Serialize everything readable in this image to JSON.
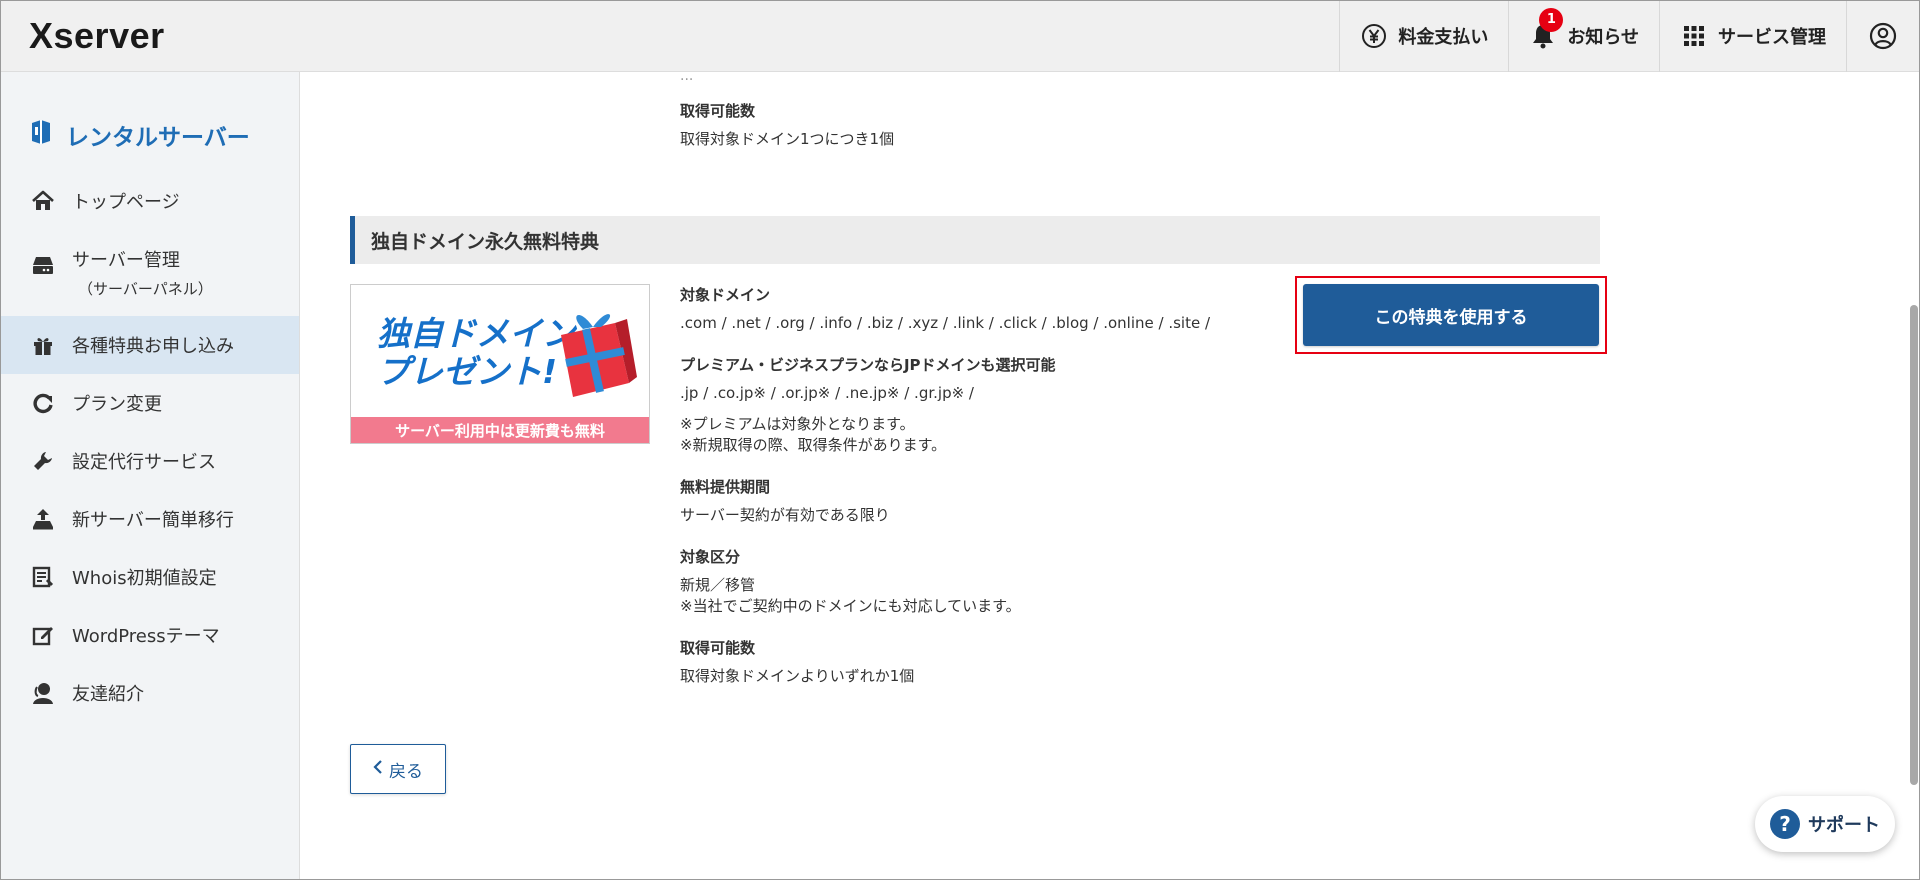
{
  "header": {
    "logo": "Xserver",
    "nav": {
      "payment": "料金支払い",
      "notifications": "お知らせ",
      "notification_count": "1",
      "service_management": "サービス管理"
    }
  },
  "sidebar": {
    "title": "レンタルサーバー",
    "items": [
      {
        "label": "トップページ",
        "icon": "home-icon"
      },
      {
        "label": "サーバー管理",
        "sub": "（サーバーパネル）",
        "icon": "server-icon"
      },
      {
        "label": "各種特典お申し込み",
        "icon": "gift-icon",
        "active": true
      },
      {
        "label": "プラン変更",
        "icon": "refresh-icon"
      },
      {
        "label": "設定代行サービス",
        "icon": "wrench-icon"
      },
      {
        "label": "新サーバー簡単移行",
        "icon": "upload-server-icon"
      },
      {
        "label": "Whois初期値設定",
        "icon": "document-icon"
      },
      {
        "label": "WordPressテーマ",
        "icon": "edit-icon"
      },
      {
        "label": "友達紹介",
        "icon": "user-icon"
      }
    ]
  },
  "main": {
    "cropped_text": "...",
    "top_block": {
      "label": "取得可能数",
      "value": "取得対象ドメイン1つにつき1個"
    },
    "section_title": "独自ドメイン永久無料特典",
    "promo": {
      "line1": "独自ドメイン",
      "line2": "プレゼント!",
      "band": "サーバー利用中は更新費も無料"
    },
    "details": {
      "target_domain_label": "対象ドメイン",
      "target_domain_value": ".com / .net / .org / .info / .biz / .xyz / .link / .click / .blog / .online / .site /",
      "premium_label": "プレミアム・ビジネスプランならJPドメインも選択可能",
      "premium_value": ".jp / .co.jp※ / .or.jp※ / .ne.jp※ / .gr.jp※ /",
      "premium_note1": "※プレミアムは対象外となります。",
      "premium_note2": "※新規取得の際、取得条件があります。",
      "period_label": "無料提供期間",
      "period_value": "サーバー契約が有効である限り",
      "category_label": "対象区分",
      "category_value": "新規／移管",
      "category_note": "※当社でご契約中のドメインにも対応しています。",
      "count_label": "取得可能数",
      "count_value": "取得対象ドメインよりいずれか1個"
    },
    "use_button": "この特典を使用する",
    "back_button": "戻る"
  },
  "support": {
    "label": "サポート"
  },
  "colors": {
    "brand_blue": "#1f5c99",
    "sidebar_active": "#d9e6f2",
    "highlight_red": "#e60012",
    "promo_pink": "#f27a8e"
  }
}
